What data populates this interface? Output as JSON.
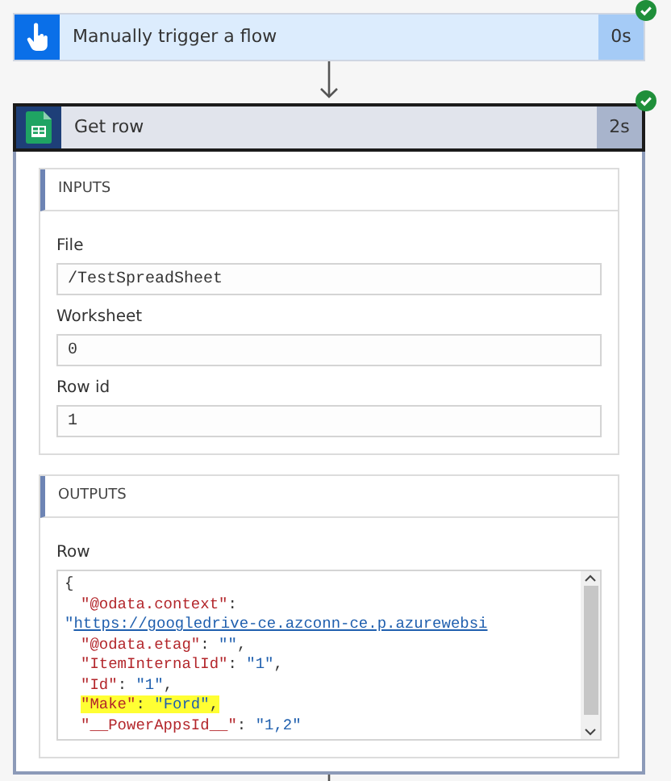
{
  "steps": [
    {
      "kind": "trigger",
      "title": "Manually trigger a flow",
      "duration": "0s",
      "succeeded": true,
      "selected": false
    },
    {
      "kind": "sheet",
      "title": "Get row",
      "duration": "2s",
      "succeeded": true,
      "selected": true
    }
  ],
  "inputs": {
    "heading": "INPUTS",
    "fields": [
      {
        "label": "File",
        "value": "/TestSpreadSheet"
      },
      {
        "label": "Worksheet",
        "value": "0"
      },
      {
        "label": "Row id",
        "value": "1"
      }
    ]
  },
  "outputs": {
    "heading": "OUTPUTS",
    "label": "Row",
    "lines": [
      {
        "highlighted": false,
        "segments": [
          {
            "kind": "punct",
            "text": "{"
          }
        ]
      },
      {
        "highlighted": false,
        "segments": [
          {
            "kind": "key",
            "text": "\"@odata.context\""
          },
          {
            "kind": "punct",
            "text": ": "
          },
          {
            "kind": "string",
            "text": "\""
          },
          {
            "kind": "link",
            "text": "https://googledrive-ce.azconn-ce.p.azurewebsi"
          }
        ]
      },
      {
        "highlighted": false,
        "segments": [
          {
            "kind": "key",
            "text": "\"@odata.etag\""
          },
          {
            "kind": "punct",
            "text": ": "
          },
          {
            "kind": "string",
            "text": "\"\""
          },
          {
            "kind": "punct",
            "text": ","
          }
        ]
      },
      {
        "highlighted": false,
        "segments": [
          {
            "kind": "key",
            "text": "\"ItemInternalId\""
          },
          {
            "kind": "punct",
            "text": ": "
          },
          {
            "kind": "string",
            "text": "\"1\""
          },
          {
            "kind": "punct",
            "text": ","
          }
        ]
      },
      {
        "highlighted": false,
        "segments": [
          {
            "kind": "key",
            "text": "\"Id\""
          },
          {
            "kind": "punct",
            "text": ": "
          },
          {
            "kind": "string",
            "text": "\"1\""
          },
          {
            "kind": "punct",
            "text": ","
          }
        ]
      },
      {
        "highlighted": true,
        "segments": [
          {
            "kind": "key",
            "text": "\"Make\""
          },
          {
            "kind": "punct",
            "text": ": "
          },
          {
            "kind": "string",
            "text": "\"Ford\""
          },
          {
            "kind": "punct",
            "text": ","
          }
        ]
      },
      {
        "highlighted": false,
        "segments": [
          {
            "kind": "key",
            "text": "\"__PowerAppsId__\""
          },
          {
            "kind": "punct",
            "text": ": "
          },
          {
            "kind": "string",
            "text": "\"1,2\""
          }
        ]
      }
    ]
  }
}
